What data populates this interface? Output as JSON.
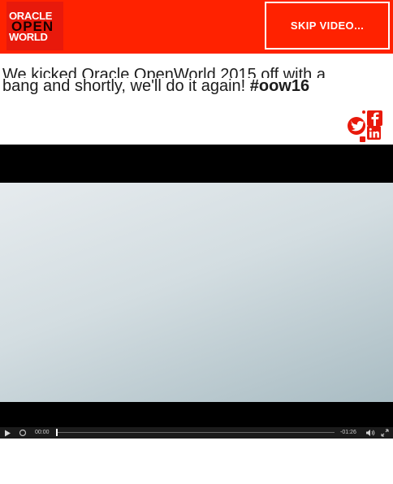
{
  "header": {
    "logo": {
      "line1": "ORACLE",
      "line2": "OPEN",
      "line3": "WORLD"
    },
    "skip_label": "SKIP  VIDEO..."
  },
  "headline": {
    "text_line1": "We kicked Oracle OpenWorld 2015 off with a",
    "text_line2": "bang and shortly, we'll do it again! ",
    "hashtag": "#oow16"
  },
  "social": {
    "icons": [
      "twitter-icon",
      "facebook-icon",
      "linkedin-icon"
    ],
    "color": "#e8190b"
  },
  "video": {
    "current_time": "00:00",
    "duration": "-01:26",
    "progress": 0
  },
  "colors": {
    "header_bg": "#ff2200",
    "accent": "#e8190b"
  }
}
